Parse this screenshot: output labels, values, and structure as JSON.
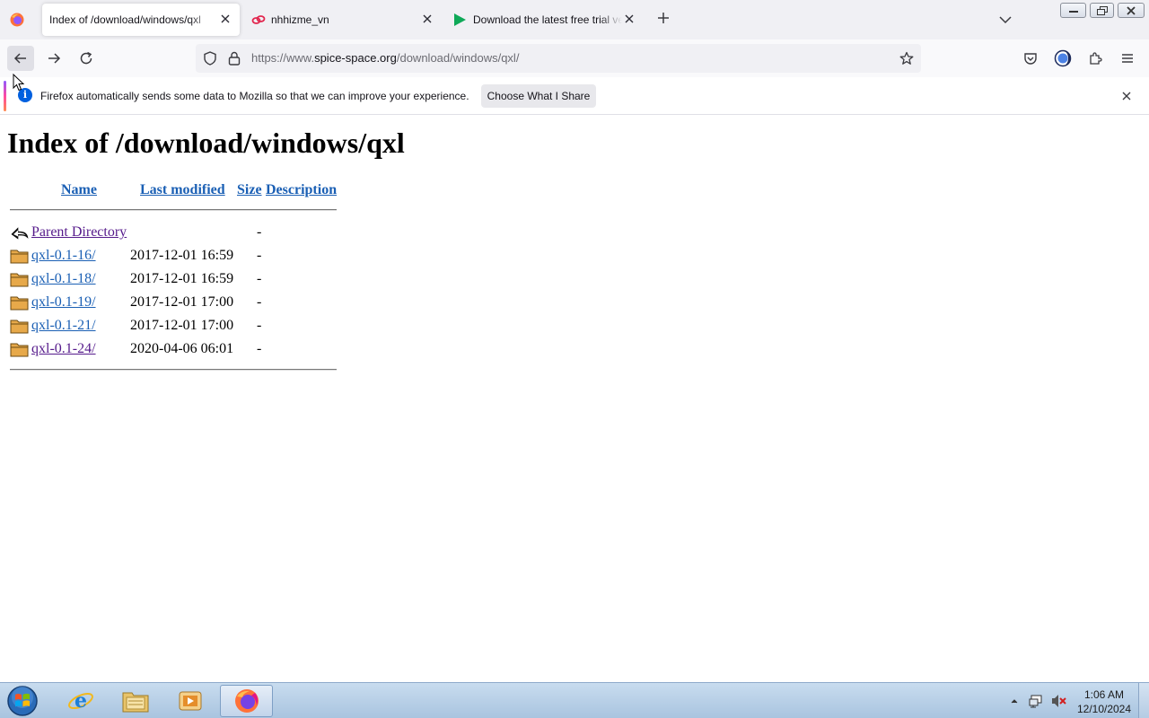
{
  "browser": {
    "tabs": [
      {
        "title": "Index of /download/windows/qxl",
        "active": true,
        "icon": "page-icon"
      },
      {
        "title": "nhhizme_vn",
        "active": false,
        "icon": "link-chain-icon"
      },
      {
        "title": "Download the latest free trial ve",
        "active": false,
        "icon": "green-play-icon"
      }
    ],
    "url_scheme": "https://www.",
    "url_host": "spice-space.org",
    "url_path": "/download/windows/qxl/"
  },
  "notification": {
    "message": "Firefox automatically sends some data to Mozilla so that we can improve your experience.",
    "button_label": "Choose What I Share"
  },
  "page": {
    "title": "Index of /download/windows/qxl",
    "columns": [
      "Name",
      "Last modified",
      "Size",
      "Description"
    ],
    "parent": {
      "name": "Parent Directory",
      "size": "-"
    },
    "entries": [
      {
        "name": "qxl-0.1-16/",
        "modified": "2017-12-01 16:59",
        "size": "-"
      },
      {
        "name": "qxl-0.1-18/",
        "modified": "2017-12-01 16:59",
        "size": "-"
      },
      {
        "name": "qxl-0.1-19/",
        "modified": "2017-12-01 17:00",
        "size": "-"
      },
      {
        "name": "qxl-0.1-21/",
        "modified": "2017-12-01 17:00",
        "size": "-"
      },
      {
        "name": "qxl-0.1-24/",
        "modified": "2020-04-06 06:01",
        "size": "-"
      }
    ]
  },
  "taskbar": {
    "apps": [
      "internet-explorer-icon",
      "file-explorer-icon",
      "media-player-icon",
      "firefox-icon"
    ],
    "time": "1:06 AM",
    "date": "12/10/2024"
  },
  "colors": {
    "link": "#1a5fb4",
    "visited_link": "#551a8b",
    "accent_blue": "#0060df"
  }
}
